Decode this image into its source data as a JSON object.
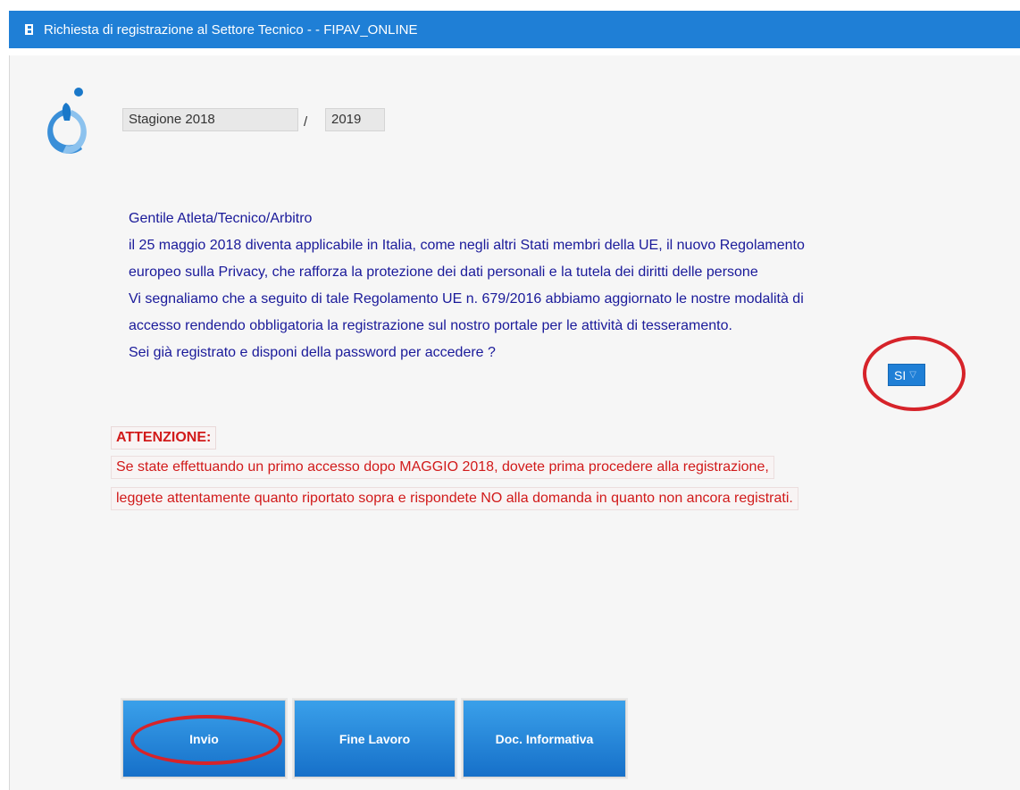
{
  "window": {
    "title": "Richiesta di registrazione al Settore Tecnico - - FIPAV_ONLINE",
    "title_icon": "document-icon",
    "accent_color": "#1f7fd6"
  },
  "season": {
    "from_value": "Stagione 2018",
    "separator": "/",
    "to_value": "2019"
  },
  "notice": {
    "lines": [
      "Gentile Atleta/Tecnico/Arbitro",
      "il 25 maggio 2018 diventa applicabile in Italia, come negli altri Stati membri della UE, il nuovo Regolamento",
      "europeo sulla Privacy, che rafforza la protezione dei dati personali e la tutela dei diritti delle persone",
      "Vi segnaliamo che a seguito di tale Regolamento UE n. 679/2016 abbiamo aggiornato le nostre modalità di",
      "accesso rendendo obbligatoria la registrazione sul nostro portale per le attività di tesseramento."
    ],
    "question": "Sei già registrato e disponi della password per accedere ?",
    "answer_selected": "SI",
    "text_color": "#1a1a9a"
  },
  "warning": {
    "heading": "ATTENZIONE:",
    "line1": "Se state effettuando un primo accesso dopo MAGGIO 2018, dovete prima procedere alla registrazione,",
    "line2": "leggete attentamente quanto riportato sopra e rispondete NO alla domanda in quanto non ancora registrati.",
    "color": "#d11a1a"
  },
  "buttons": {
    "invio": "Invio",
    "fine_lavoro": "Fine Lavoro",
    "doc_informativa": "Doc. Informativa"
  },
  "annotation_color": "#d6232a"
}
